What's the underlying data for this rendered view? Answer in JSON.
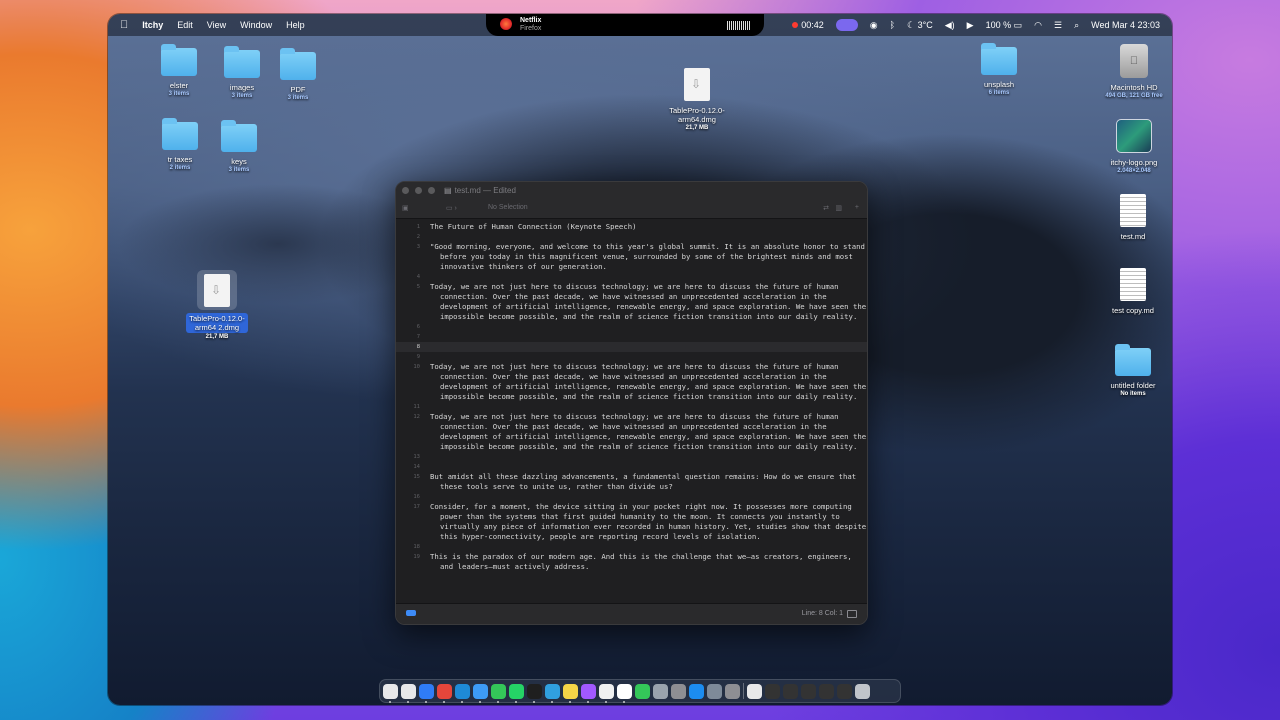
{
  "menubar": {
    "apple": "",
    "app": "Itchy",
    "menus": [
      "Edit",
      "View",
      "Window",
      "Help"
    ],
    "now_playing": {
      "title": "Netflix",
      "source": "Firefox"
    },
    "record_time": "00:42",
    "temperature": "3°C",
    "battery": "100 %",
    "datetime": "Wed Mar 4  23:03"
  },
  "desktop": {
    "folders": [
      {
        "name": "elster",
        "sub": "3 items"
      },
      {
        "name": "images",
        "sub": "3 items"
      },
      {
        "name": "PDF",
        "sub": "3 items"
      },
      {
        "name": "tr taxes",
        "sub": "2 items"
      },
      {
        "name": "keys",
        "sub": "3 items"
      },
      {
        "name": "unsplash",
        "sub": "6 items"
      },
      {
        "name": "untitled folder",
        "sub": "No items"
      }
    ],
    "dmg_top": {
      "name": "TablePro-0.12.0-arm64.dmg",
      "sub": "21,7 MB"
    },
    "dmg_selected": {
      "name_line1": "TablePro-0.12.0-",
      "name_line2": "arm64 2.dmg",
      "sub": "21,7 MB"
    },
    "hdd": {
      "name": "Macintosh HD",
      "sub": "494 GB, 121 GB free"
    },
    "png": {
      "name": "itchy-logo.png",
      "sub": "2.048×2.048"
    },
    "files": [
      {
        "name": "test.md"
      },
      {
        "name": "test copy.md"
      }
    ]
  },
  "editor": {
    "title": "test.md — Edited",
    "toolbar_status": "No Selection",
    "current_line": 8,
    "lines": [
      {
        "n": "1",
        "text": "The Future of Human Connection (Keynote Speech)"
      },
      {
        "n": "2",
        "text": ""
      },
      {
        "n": "3",
        "text": "\"Good morning, everyone, and welcome to this year's global summit. It is an absolute honor to stand before you today in this magnificent venue, surrounded by some of the brightest minds and most innovative thinkers of our generation."
      },
      {
        "n": "4",
        "text": ""
      },
      {
        "n": "5",
        "text": "Today, we are not just here to discuss technology; we are here to discuss the future of human connection. Over the past decade, we have witnessed an unprecedented acceleration in the development of artificial intelligence, renewable energy, and space exploration. We have seen the impossible become possible, and the realm of science fiction transition into our daily reality."
      },
      {
        "n": "6",
        "text": ""
      },
      {
        "n": "7",
        "text": ""
      },
      {
        "n": "8",
        "text": ""
      },
      {
        "n": "9",
        "text": ""
      },
      {
        "n": "10",
        "text": "Today, we are not just here to discuss technology; we are here to discuss the future of human connection. Over the past decade, we have witnessed an unprecedented acceleration in the development of artificial intelligence, renewable energy, and space exploration. We have seen the impossible become possible, and the realm of science fiction transition into our daily reality."
      },
      {
        "n": "11",
        "text": ""
      },
      {
        "n": "12",
        "text": "Today, we are not just here to discuss technology; we are here to discuss the future of human connection. Over the past decade, we have witnessed an unprecedented acceleration in the development of artificial intelligence, renewable energy, and space exploration. We have seen the impossible become possible, and the realm of science fiction transition into our daily reality."
      },
      {
        "n": "13",
        "text": ""
      },
      {
        "n": "14",
        "text": ""
      },
      {
        "n": "15",
        "text": "But amidst all these dazzling advancements, a fundamental question remains: How do we ensure that these tools serve to unite us, rather than divide us?"
      },
      {
        "n": "16",
        "text": ""
      },
      {
        "n": "17",
        "text": "Consider, for a moment, the device sitting in your pocket right now. It possesses more computing power than the systems that first guided humanity to the moon. It connects you instantly to virtually any piece of information ever recorded in human history. Yet, studies show that despite this hyper-connectivity, people are reporting record levels of isolation."
      },
      {
        "n": "18",
        "text": ""
      },
      {
        "n": "19",
        "text": "This is the paradox of our modern age. And this is the challenge that we—as creators, engineers, and leaders—must actively address."
      }
    ],
    "status": "Line: 8  Col: 1"
  },
  "dock": {
    "colors": [
      "#e8e8ea",
      "#e8e8ea",
      "#2f7cf6",
      "#e5463b",
      "#1e8ad6",
      "#3d9bf6",
      "#34c759",
      "#25d366",
      "#1f1f1f",
      "#30a0e0",
      "#f5d547",
      "#a259ff",
      "#f0f0f0",
      "#ffffff",
      "#34c759",
      "#9aa3ad",
      "#8e8e93",
      "#1c8cf0",
      "#7e8a99",
      "#8e8e93",
      "#e8e8ea",
      "#333",
      "#333",
      "#333",
      "#333",
      "#333",
      "#c0c4ca"
    ]
  }
}
